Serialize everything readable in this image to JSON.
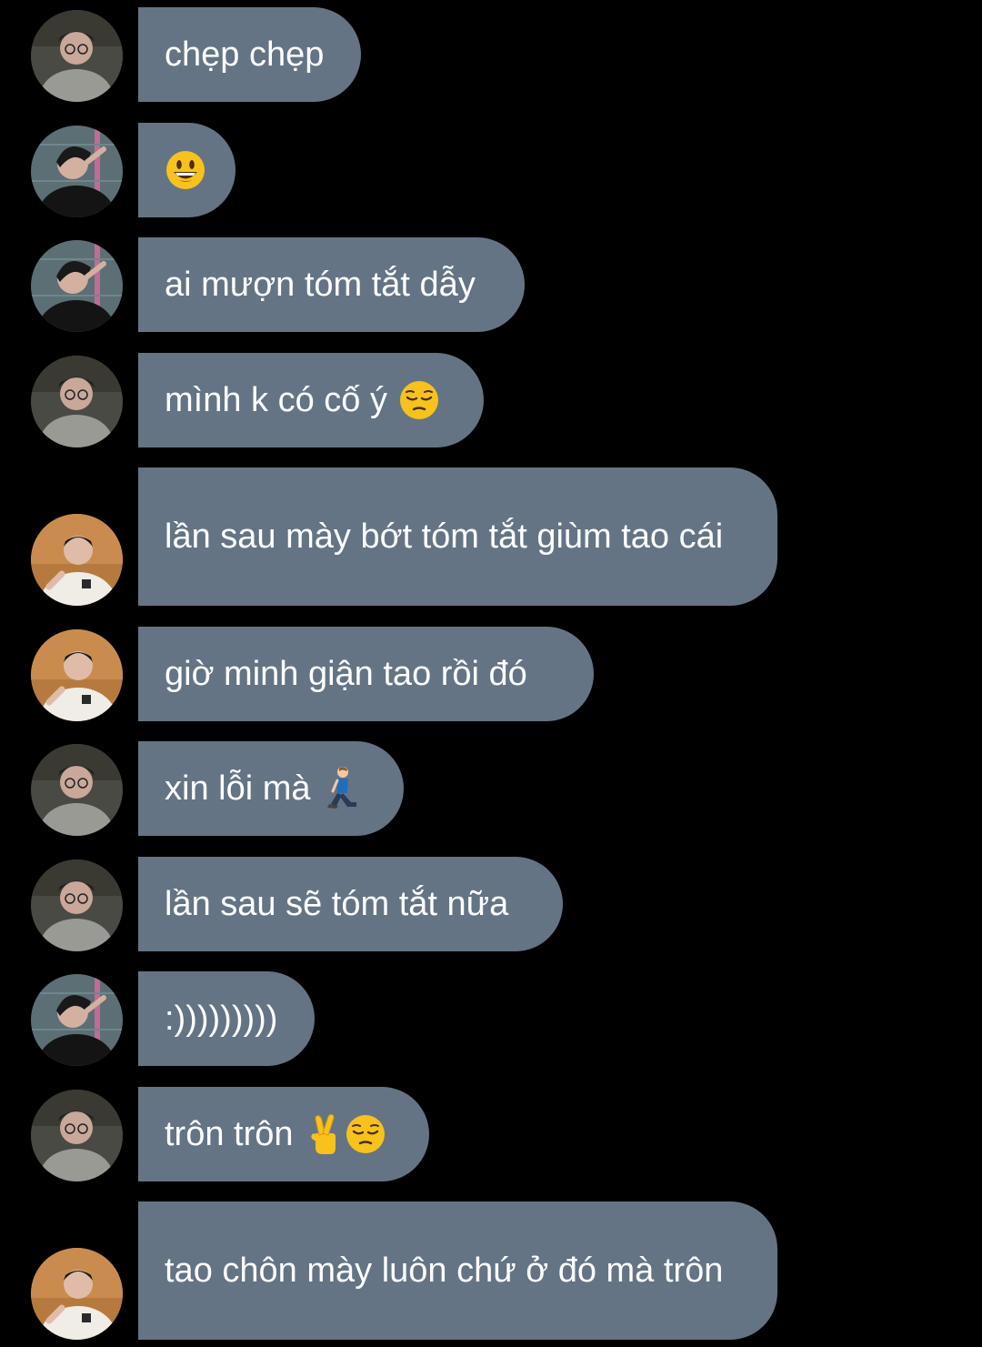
{
  "messages": [
    {
      "sender": "a",
      "text": "chẹp chẹp",
      "emojis": []
    },
    {
      "sender": "b",
      "text": "",
      "emojis": [
        "grinning-face"
      ]
    },
    {
      "sender": "b",
      "text": "ai mượn tóm tắt dẫy",
      "emojis": []
    },
    {
      "sender": "a",
      "text": "mình k có cố ý",
      "emojis": [
        "pensive-face"
      ]
    },
    {
      "sender": "c",
      "text": "lần sau mày bớt tóm tắt giùm tao cái",
      "emojis": []
    },
    {
      "sender": "c",
      "text": "giờ minh giận tao rồi đó",
      "emojis": []
    },
    {
      "sender": "a",
      "text": "xin lỗi mà",
      "emojis": [
        "kneeling-person"
      ]
    },
    {
      "sender": "a",
      "text": "lần sau sẽ tóm tắt nữa",
      "emojis": []
    },
    {
      "sender": "b",
      "text": ":)))))))))",
      "emojis": []
    },
    {
      "sender": "a",
      "text": "trôn trôn",
      "emojis": [
        "crossed-fingers",
        "pensive-face"
      ]
    },
    {
      "sender": "c",
      "text": "tao chôn mày luôn chứ ở đó mà trôn",
      "emojis": []
    }
  ],
  "colors": {
    "background": "#000000",
    "bubble": "#647484",
    "bubble_text": "#ffffff"
  },
  "avatars": {
    "a": "avatar-person-glasses-icon",
    "b": "avatar-person-black-shirt-icon",
    "c": "avatar-person-white-shirt-icon"
  }
}
